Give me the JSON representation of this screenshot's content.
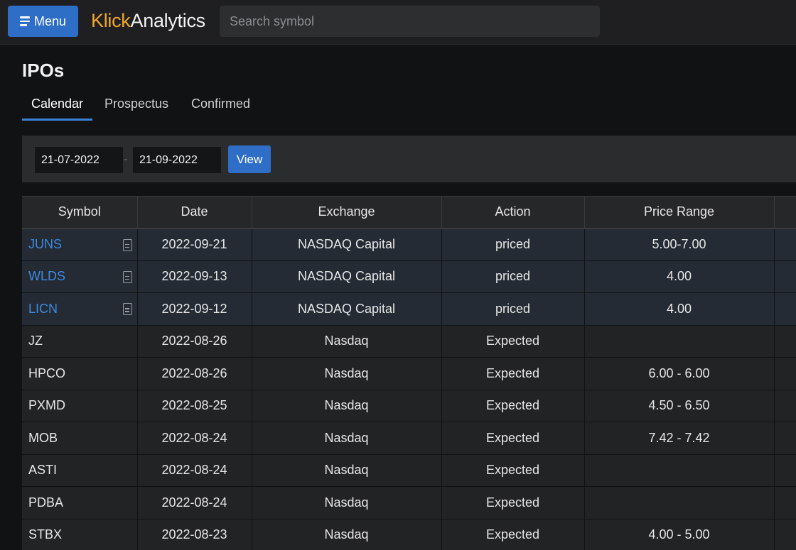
{
  "header": {
    "menu_label": "Menu",
    "brand_part1": "Klick",
    "brand_part2": "Analytics",
    "search_placeholder": "Search symbol"
  },
  "page": {
    "title": "IPOs",
    "tabs": [
      {
        "label": "Calendar",
        "active": true
      },
      {
        "label": "Prospectus",
        "active": false
      },
      {
        "label": "Confirmed",
        "active": false
      }
    ]
  },
  "filter": {
    "from_date": "21-07-2022",
    "separator": "-",
    "to_date": "21-09-2022",
    "view_label": "View"
  },
  "table": {
    "columns": [
      "Symbol",
      "Date",
      "Exchange",
      "Action",
      "Price Range"
    ],
    "rows": [
      {
        "symbol": "JUNS",
        "link": true,
        "date": "2022-09-21",
        "exchange": "NASDAQ Capital",
        "action": "priced",
        "price_range": "5.00-7.00"
      },
      {
        "symbol": "WLDS",
        "link": true,
        "date": "2022-09-13",
        "exchange": "NASDAQ Capital",
        "action": "priced",
        "price_range": "4.00"
      },
      {
        "symbol": "LICN",
        "link": true,
        "date": "2022-09-12",
        "exchange": "NASDAQ Capital",
        "action": "priced",
        "price_range": "4.00"
      },
      {
        "symbol": "JZ",
        "link": false,
        "date": "2022-08-26",
        "exchange": "Nasdaq",
        "action": "Expected",
        "price_range": ""
      },
      {
        "symbol": "HPCO",
        "link": false,
        "date": "2022-08-26",
        "exchange": "Nasdaq",
        "action": "Expected",
        "price_range": "6.00 - 6.00"
      },
      {
        "symbol": "PXMD",
        "link": false,
        "date": "2022-08-25",
        "exchange": "Nasdaq",
        "action": "Expected",
        "price_range": "4.50 - 6.50"
      },
      {
        "symbol": "MOB",
        "link": false,
        "date": "2022-08-24",
        "exchange": "Nasdaq",
        "action": "Expected",
        "price_range": "7.42 - 7.42"
      },
      {
        "symbol": "ASTI",
        "link": false,
        "date": "2022-08-24",
        "exchange": "Nasdaq",
        "action": "Expected",
        "price_range": ""
      },
      {
        "symbol": "PDBA",
        "link": false,
        "date": "2022-08-24",
        "exchange": "Nasdaq",
        "action": "Expected",
        "price_range": ""
      },
      {
        "symbol": "STBX",
        "link": false,
        "date": "2022-08-23",
        "exchange": "Nasdaq",
        "action": "Expected",
        "price_range": "4.00 - 5.00"
      }
    ]
  },
  "colors": {
    "accent": "#2f6ec7",
    "brand_orange": "#f0a824",
    "link": "#3d8ae0",
    "background": "#111213"
  }
}
